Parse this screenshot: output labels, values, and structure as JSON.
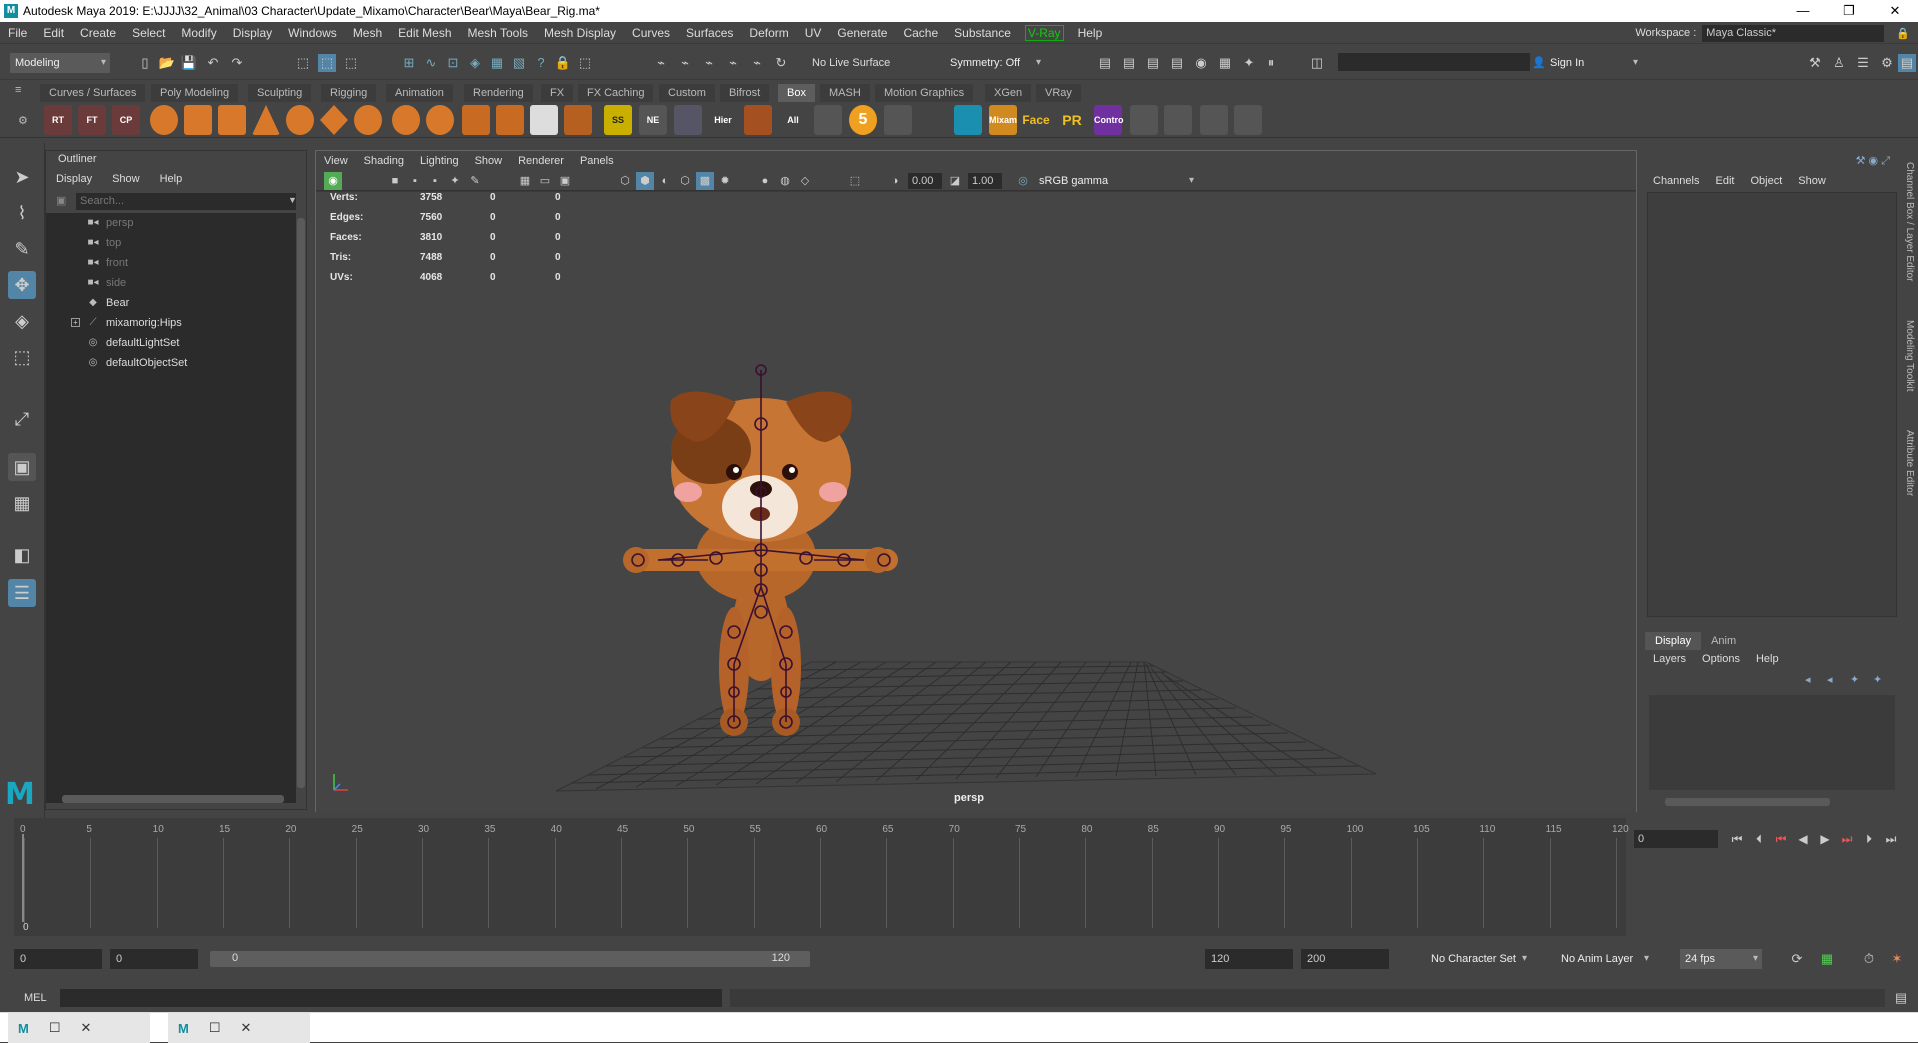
{
  "window": {
    "title": "Autodesk Maya 2019: E:\\JJJJ\\32_Animal\\03 Character\\Update_Mixamo\\Character\\Bear\\Maya\\Bear_Rig.ma*",
    "app_icon": "M",
    "controls": [
      "—",
      "❐",
      "✕"
    ]
  },
  "menubar": {
    "items": [
      "File",
      "Edit",
      "Create",
      "Select",
      "Modify",
      "Display",
      "Windows",
      "Mesh",
      "Edit Mesh",
      "Mesh Tools",
      "Mesh Display",
      "Curves",
      "Surfaces",
      "Deform",
      "UV",
      "Generate",
      "Cache",
      "Substance"
    ],
    "vray": "V-Ray",
    "help": "Help"
  },
  "workspace": {
    "label": "Workspace :",
    "value": "Maya Classic*"
  },
  "statusline": {
    "menuset": "Modeling",
    "live_surface": "No Live Surface",
    "symmetry": "Symmetry: Off",
    "sign_in": "Sign In"
  },
  "shelf": {
    "tabs": [
      "Curves / Surfaces",
      "Poly Modeling",
      "Sculpting",
      "Rigging",
      "Animation",
      "Rendering",
      "FX",
      "FX Caching",
      "Custom",
      "Bifrost",
      "Box",
      "MASH",
      "Motion Graphics",
      "XGen",
      "VRay"
    ],
    "active_tab": "Box",
    "icons": [
      "RT",
      "FT",
      "CP",
      "",
      "",
      "",
      "",
      "",
      "",
      "",
      "",
      "",
      "",
      "",
      "",
      "",
      "SS",
      "NE",
      "",
      "Hier",
      "",
      "All",
      "",
      "5",
      "",
      "",
      "",
      "Mixam",
      "Face",
      "PR",
      "Contro",
      "",
      "",
      "",
      ""
    ]
  },
  "outliner": {
    "title": "Outliner",
    "menu": [
      "Display",
      "Show",
      "Help"
    ],
    "search_placeholder": "Search...",
    "items": [
      {
        "label": "persp",
        "icon": "camera-icon",
        "dim": true
      },
      {
        "label": "top",
        "icon": "camera-icon",
        "dim": true
      },
      {
        "label": "front",
        "icon": "camera-icon",
        "dim": true
      },
      {
        "label": "side",
        "icon": "camera-icon",
        "dim": true
      },
      {
        "label": "Bear",
        "icon": "mesh-icon",
        "dim": false
      },
      {
        "label": "mixamorig:Hips",
        "icon": "joint-icon",
        "dim": false,
        "expandable": true
      },
      {
        "label": "defaultLightSet",
        "icon": "set-icon",
        "dim": false
      },
      {
        "label": "defaultObjectSet",
        "icon": "set-icon",
        "dim": false
      }
    ]
  },
  "viewport": {
    "menu": [
      "View",
      "Shading",
      "Lighting",
      "Show",
      "Renderer",
      "Panels"
    ],
    "exposure": "0.00",
    "gamma": "1.00",
    "color_space": "sRGB gamma",
    "camera_label": "persp",
    "hud": [
      {
        "label": "Verts:",
        "a": "3758",
        "b": "0",
        "c": "0"
      },
      {
        "label": "Edges:",
        "a": "7560",
        "b": "0",
        "c": "0"
      },
      {
        "label": "Faces:",
        "a": "3810",
        "b": "0",
        "c": "0"
      },
      {
        "label": "Tris:",
        "a": "7488",
        "b": "0",
        "c": "0"
      },
      {
        "label": "UVs:",
        "a": "4068",
        "b": "0",
        "c": "0"
      }
    ]
  },
  "channelbox": {
    "menu": [
      "Channels",
      "Edit",
      "Object",
      "Show"
    ],
    "layer_tabs": [
      "Display",
      "Anim"
    ],
    "layer_menu": [
      "Layers",
      "Options",
      "Help"
    ]
  },
  "side_tabs": [
    "Channel Box / Layer Editor",
    "Modeling Toolkit",
    "Attribute Editor"
  ],
  "timeline": {
    "ticks": [
      "0",
      "5",
      "10",
      "15",
      "20",
      "25",
      "30",
      "35",
      "40",
      "45",
      "50",
      "55",
      "60",
      "65",
      "70",
      "75",
      "80",
      "85",
      "90",
      "95",
      "100",
      "105",
      "110",
      "115",
      "120"
    ],
    "current_frame_marker": "0",
    "current_frame": "0"
  },
  "range": {
    "start": "0",
    "playback_start": "0",
    "slider_start": "0",
    "slider_end": "120",
    "playback_end": "120",
    "end": "200",
    "character_set": "No Character Set",
    "anim_layer": "No Anim Layer",
    "fps": "24 fps"
  },
  "cmdline": {
    "label": "MEL"
  },
  "taskbar": {
    "windows": [
      "M",
      "M"
    ]
  },
  "colors": {
    "accent": "#5285a6",
    "bear_body": "#b8672a",
    "joint": "#3b1030"
  }
}
